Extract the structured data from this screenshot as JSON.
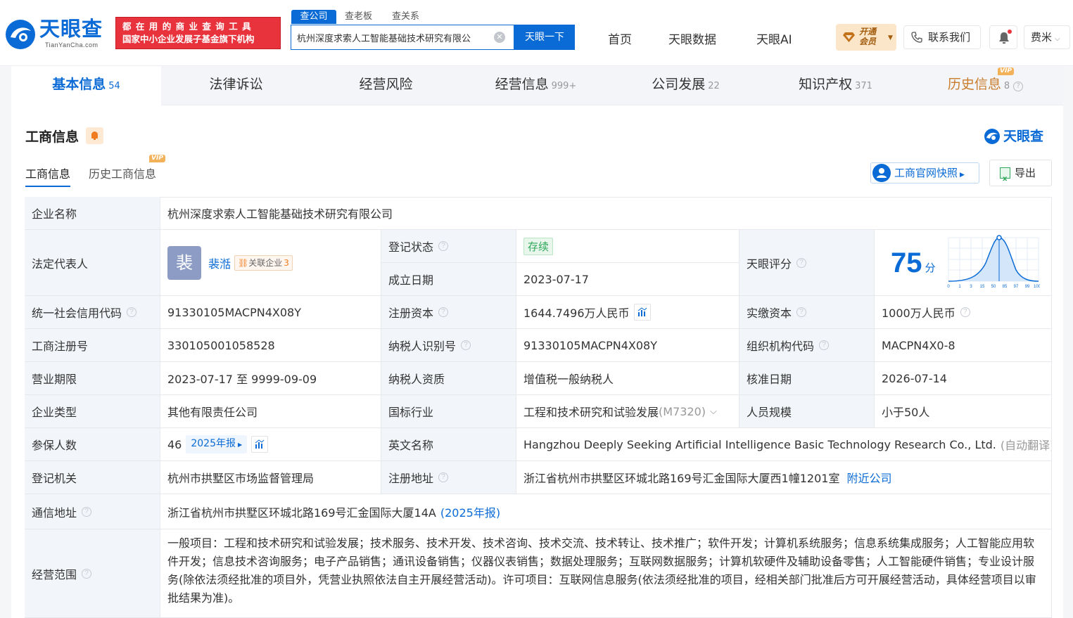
{
  "header": {
    "logo_name": "天眼查",
    "logo_domain": "TianYanCha.com",
    "slogan_line1": "都在用的商业查询工具",
    "slogan_line2": "国家中小企业发展子基金旗下机构",
    "search_tabs": [
      "查公司",
      "查老板",
      "查关系"
    ],
    "search_value": "杭州深度求索人工智能基础技术研究有限公",
    "search_button": "天眼一下",
    "nav": [
      "首页",
      "天眼数据",
      "天眼AI"
    ],
    "vip_line1": "开通",
    "vip_line2": "会员",
    "contact_label": "联系我们",
    "user_name": "费米",
    "brand_color": "#0a6bd6",
    "accent_color": "#e8333d"
  },
  "tabs": [
    {
      "label": "基本信息",
      "count": "54"
    },
    {
      "label": "法律诉讼",
      "count": ""
    },
    {
      "label": "经营风险",
      "count": ""
    },
    {
      "label": "经营信息",
      "count": "999+"
    },
    {
      "label": "公司发展",
      "count": "22"
    },
    {
      "label": "知识产权",
      "count": "371"
    },
    {
      "label": "历史信息",
      "count": "8",
      "vip": "VIP"
    }
  ],
  "section": {
    "title": "工商信息",
    "brand": "天眼查",
    "subtab_basic": "工商信息",
    "subtab_history": "历史工商信息",
    "vip": "VIP",
    "snapshot_button": "工商官网快照",
    "export_button": "导出"
  },
  "info": {
    "company_name_label": "企业名称",
    "company_name": "杭州深度求索人工智能基础技术研究有限公司",
    "legal_rep_label": "法定代表人",
    "legal_rep_avatar": "裴",
    "legal_rep": "裴湉",
    "related_label": "关联企业",
    "related_count": "3",
    "reg_status_label": "登记状态",
    "reg_status": "存续",
    "founded_label": "成立日期",
    "founded": "2023-07-17",
    "score_label": "天眼评分",
    "score": "75",
    "score_unit": "分",
    "score_ticks": [
      "0",
      "1",
      "3",
      "15",
      "50",
      "85",
      "97",
      "99",
      "100"
    ],
    "credit_code_label": "统一社会信用代码",
    "credit_code": "91330105MACPN4X08Y",
    "reg_capital_label": "注册资本",
    "reg_capital": "1644.7496万人民币",
    "paid_capital_label": "实缴资本",
    "paid_capital": "1000万人民币",
    "reg_no_label": "工商注册号",
    "reg_no": "330105001058528",
    "taxpayer_id_label": "纳税人识别号",
    "taxpayer_id": "91330105MACPN4X08Y",
    "org_code_label": "组织机构代码",
    "org_code": "MACPN4X0-8",
    "term_label": "营业期限",
    "term": "2023-07-17 至 9999-09-09",
    "tax_qual_label": "纳税人资质",
    "tax_qual": "增值税一般纳税人",
    "approval_label": "核准日期",
    "approval": "2026-07-14",
    "type_label": "企业类型",
    "type": "其他有限责任公司",
    "industry_label": "国标行业",
    "industry": "工程和技术研究和试验发展",
    "industry_code": "(M7320)",
    "staff_label": "人员规模",
    "staff": "小于50人",
    "insured_label": "参保人数",
    "insured": "46",
    "insured_report": "2025年报",
    "english_name_label": "英文名称",
    "english_name": "Hangzhou Deeply Seeking Artificial Intelligence Basic Technology Research Co., Ltd.",
    "auto_translate": "(自动翻译)",
    "authority_label": "登记机关",
    "authority": "杭州市拱墅区市场监督管理局",
    "reg_address_label": "注册地址",
    "reg_address": "浙江省杭州市拱墅区环城北路169号汇金国际大厦西1幢1201室",
    "nearby": "附近公司",
    "mail_address_label": "通信地址",
    "mail_address": "浙江省杭州市拱墅区环城北路169号汇金国际大厦14A",
    "mail_report": "(2025年报)",
    "scope_label": "经营范围",
    "scope": "一般项目：工程和技术研究和试验发展；技术服务、技术开发、技术咨询、技术交流、技术转让、技术推广；软件开发；计算机系统服务；信息系统集成服务；人工智能应用软件开发；信息技术咨询服务；电子产品销售；通讯设备销售；仪器仪表销售；数据处理服务；互联网数据服务；计算机软硬件及辅助设备零售；人工智能硬件销售；专业设计服务(除依法须经批准的项目外，凭营业执照依法自主开展经营活动)。许可项目：互联网信息服务(依法须经批准的项目，经相关部门批准后方可开展经营活动，具体经营项目以审批结果为准)。"
  }
}
